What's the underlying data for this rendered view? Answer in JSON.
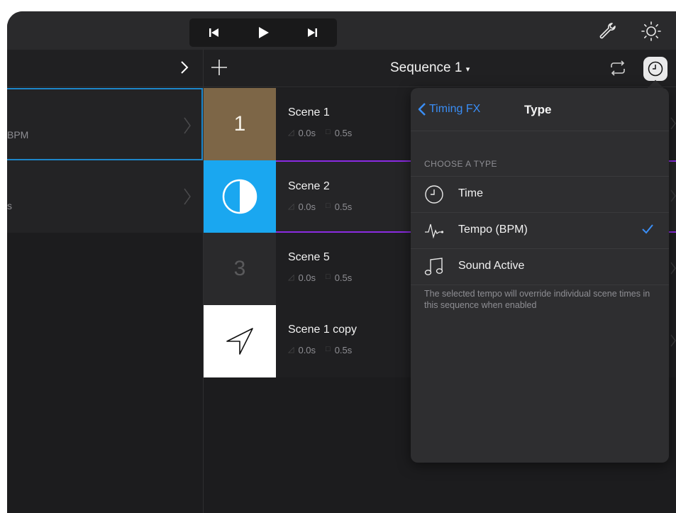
{
  "toolbar": {
    "icons": [
      "previous-icon",
      "play-icon",
      "next-icon",
      "wrench-icon",
      "brightness-icon"
    ]
  },
  "header": {
    "sequence_title": "Sequence 1",
    "sequence_caret": "▾"
  },
  "left_list": [
    {
      "subtitle": "BPM",
      "selected": true
    },
    {
      "subtitle": "s",
      "selected": false
    }
  ],
  "scenes": [
    {
      "name": "Scene 1",
      "thumb_text": "1",
      "thumb_color": "#7d6647",
      "fade": "0.0s",
      "duration": "0.5s",
      "selected": false
    },
    {
      "name": "Scene 2",
      "thumb_icon": "contrast-icon",
      "thumb_color": "#1aa7f0",
      "fade": "0.0s",
      "duration": "0.5s",
      "selected": true
    },
    {
      "name": "Scene 5",
      "thumb_text": "3",
      "thumb_color": "#2a2a2c",
      "fade": "0.0s",
      "duration": "0.5s",
      "selected": false
    },
    {
      "name": "Scene 1 copy",
      "thumb_icon": "navigation-arrow-icon",
      "thumb_color": "#ffffff",
      "fade": "0.0s",
      "duration": "0.5s",
      "selected": false
    }
  ],
  "popover": {
    "back_label": "Timing FX",
    "title": "Type",
    "section_label": "CHOOSE A TYPE",
    "options": [
      {
        "label": "Time",
        "icon": "clock-icon",
        "checked": false
      },
      {
        "label": "Tempo (BPM)",
        "icon": "pulse-icon",
        "checked": true
      },
      {
        "label": "Sound Active",
        "icon": "music-note-icon",
        "checked": false
      }
    ],
    "note": "The selected tempo will override individual scene times in this sequence when enabled"
  },
  "colors": {
    "accent": "#3a8ef6",
    "selection_blue": "#1d86c9",
    "selection_purple": "#8a2be2"
  }
}
